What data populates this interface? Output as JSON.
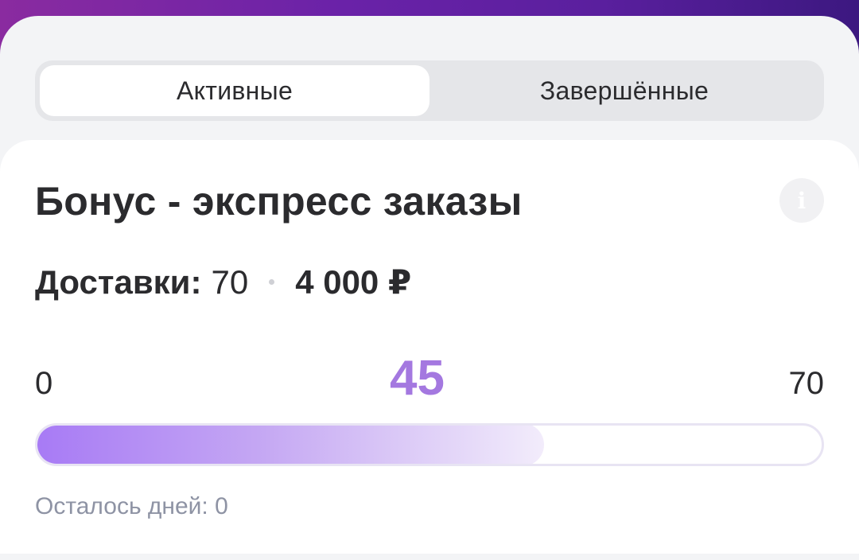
{
  "tabs": [
    {
      "label": "Активные",
      "active": true
    },
    {
      "label": "Завершённые",
      "active": false
    }
  ],
  "card": {
    "title": "Бонус - экспресс заказы",
    "info_icon": "info-icon",
    "deliveries_label": "Доставки:",
    "deliveries_count": "70",
    "amount": "4 000 ₽",
    "progress": {
      "min": "0",
      "max": "70",
      "current": "45",
      "fraction": 0.643
    },
    "days_left": "Осталось дней: 0"
  },
  "colors": {
    "accent": "#a478e0",
    "header_gradient_start": "#8a2ba0",
    "header_gradient_end": "#3c1880"
  }
}
